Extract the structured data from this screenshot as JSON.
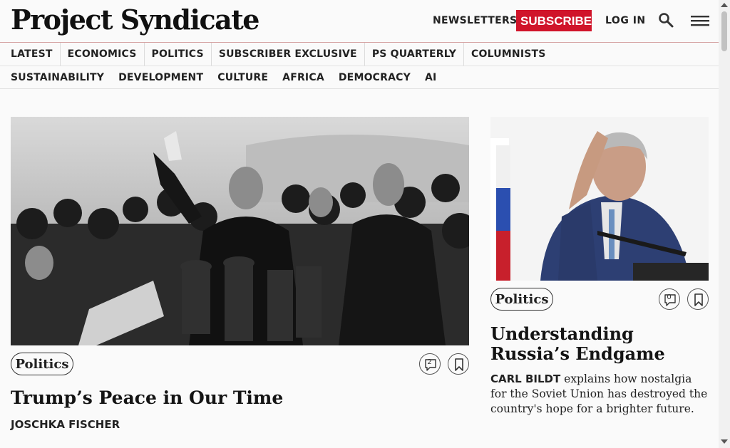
{
  "header": {
    "logo": "Project Syndicate",
    "newsletters": "NEWSLETTERS",
    "subscribe": "SUBSCRIBE",
    "login": "LOG IN",
    "brand_color": "#d0142a"
  },
  "nav_primary": [
    "LATEST",
    "ECONOMICS",
    "POLITICS",
    "SUBSCRIBER EXCLUSIVE",
    "PS QUARTERLY",
    "COLUMNISTS"
  ],
  "nav_secondary": [
    "SUSTAINABILITY",
    "DEVELOPMENT",
    "CULTURE",
    "AFRICA",
    "DEMOCRACY",
    "AI"
  ],
  "articles": {
    "main": {
      "category": "Politics",
      "comments": "2",
      "title": "Trump’s Peace in Our Time",
      "author": "JOSCHKA FISCHER"
    },
    "side": {
      "category": "Politics",
      "comments": "0",
      "title": "Understanding Russia’s Endgame",
      "author": "CARL BILDT",
      "dek": "explains how nostalgia for the Soviet Union has destroyed the country's hope for a brighter future."
    }
  },
  "icons": {
    "search": "search-icon",
    "menu": "hamburger-menu-icon",
    "comment": "comment-icon",
    "bookmark": "bookmark-icon"
  }
}
